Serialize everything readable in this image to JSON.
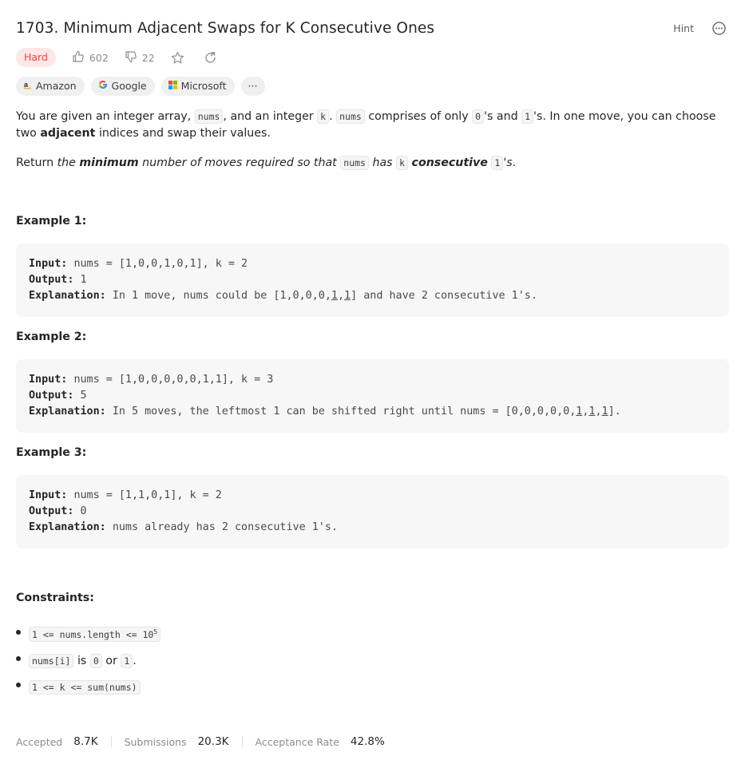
{
  "problem": {
    "title": "1703. Minimum Adjacent Swaps for K Consecutive Ones",
    "hint_label": "Hint",
    "difficulty": "Hard",
    "likes": "602",
    "dislikes": "22"
  },
  "companies": [
    {
      "name": "Amazon",
      "icon": "amazon-icon"
    },
    {
      "name": "Google",
      "icon": "google-icon"
    },
    {
      "name": "Microsoft",
      "icon": "microsoft-icon"
    }
  ],
  "more_tags_label": "···",
  "description": {
    "p1": {
      "t1": "You are given an integer array, ",
      "c1": "nums",
      "t2": ", and an integer ",
      "c2": "k",
      "t3": ". ",
      "c3": "nums",
      "t4": " comprises of only ",
      "c4": "0",
      "t5": "'s and ",
      "c5": "1",
      "t6": "'s. In one move, you can choose two ",
      "b1": "adjacent",
      "t7": " indices and swap their values."
    },
    "p2": {
      "t1": "Return ",
      "i1": "the ",
      "bi1": "minimum",
      "i2": " number of moves required so that ",
      "c1": "nums",
      "i3": " has ",
      "c2": "k",
      "i4": " ",
      "bi2": "consecutive",
      "i5": " ",
      "c3": "1",
      "i6": "'s",
      "t2": "."
    }
  },
  "examples": [
    {
      "title": "Example 1:",
      "input_label": "Input:",
      "input": "nums = [1,0,0,1,0,1], k = 2",
      "output_label": "Output:",
      "output": "1",
      "explanation_label": "Explanation:",
      "explanation_pre": "In 1 move, nums could be [1,0,0,0,",
      "u1": "1",
      "sep": ",",
      "u2": "1",
      "explanation_post": "] and have 2 consecutive 1's."
    },
    {
      "title": "Example 2:",
      "input_label": "Input:",
      "input": "nums = [1,0,0,0,0,0,1,1], k = 3",
      "output_label": "Output:",
      "output": "5",
      "explanation_label": "Explanation:",
      "explanation_pre": "In 5 moves, the leftmost 1 can be shifted right until nums = [0,0,0,0,0,",
      "u1": "1",
      "sep1": ",",
      "u2": "1",
      "sep2": ",",
      "u3": "1",
      "explanation_post": "]."
    },
    {
      "title": "Example 3:",
      "input_label": "Input:",
      "input": "nums = [1,1,0,1], k = 2",
      "output_label": "Output:",
      "output": "0",
      "explanation_label": "Explanation:",
      "explanation": "nums already has 2 consecutive 1's."
    }
  ],
  "constraints": {
    "title": "Constraints:",
    "c1_code": "1 <= nums.length <= 10",
    "c1_sup": "5",
    "c2_code": "nums[i]",
    "c2_is": " is ",
    "c2_zero": "0",
    "c2_or": " or ",
    "c2_one": "1",
    "c2_end": ".",
    "c3_code": "1 <= k <= sum(nums)"
  },
  "stats": {
    "accepted_label": "Accepted",
    "accepted": "8.7K",
    "submissions_label": "Submissions",
    "submissions": "20.3K",
    "rate_label": "Acceptance Rate",
    "rate": "42.8%"
  },
  "colors": {
    "hard_text": "#ef4743",
    "hard_bg": "#fde7e7",
    "code_bg": "#f7f7f8"
  }
}
